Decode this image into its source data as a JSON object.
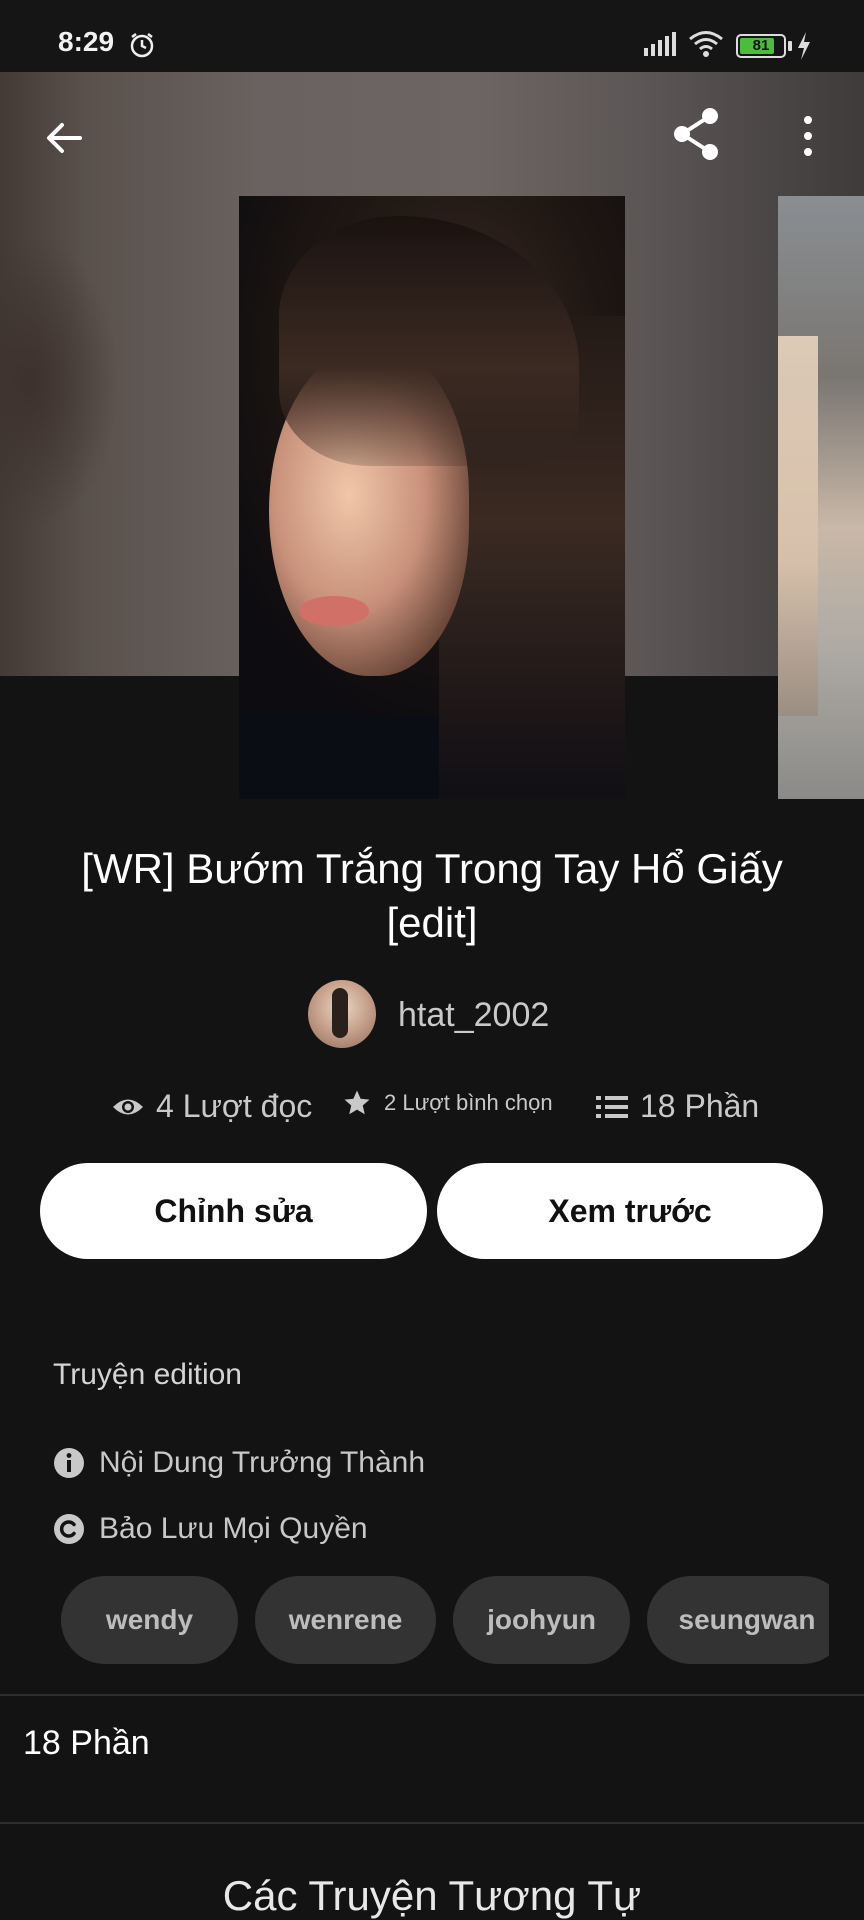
{
  "status_bar": {
    "time": "8:29",
    "battery": "81"
  },
  "story": {
    "title_line1": "[WR] Bướm Trắng Trong Tay Hổ Giấy",
    "title_line2": "[edit]",
    "author": "htat_2002",
    "reads": "4 Lượt đọc",
    "votes": "2 Lượt bình chọn",
    "parts": "18 Phần"
  },
  "actions": {
    "edit_label": "Chỉnh sửa",
    "preview_label": "Xem trước"
  },
  "description": "Truyện edition",
  "info": {
    "mature": "Nội Dung Trưởng Thành",
    "copyright": "Bảo Lưu Mọi Quyền"
  },
  "tags": [
    "wendy",
    "wenrene",
    "joohyun",
    "seungwan"
  ],
  "parts_section": {
    "label": "18 Phần"
  },
  "similar_section": {
    "title": "Các Truyện Tương Tự"
  },
  "icons": {
    "back": "arrow-left-icon",
    "share": "share-icon",
    "more": "more-vertical-icon",
    "reads": "eye-icon",
    "votes": "star-icon",
    "parts": "list-icon",
    "mature": "info-icon",
    "copyright": "copyright-icon"
  }
}
